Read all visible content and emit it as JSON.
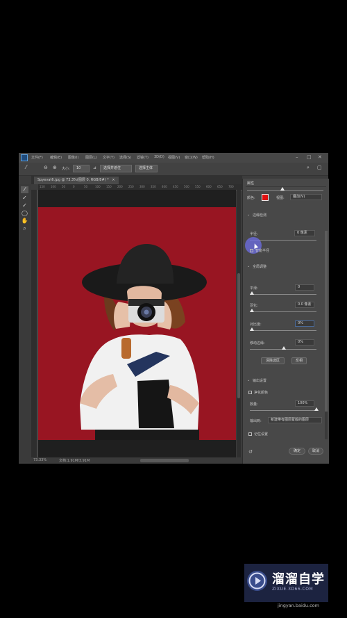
{
  "colors": {
    "canvas": "#981522",
    "swatch": "#e11010",
    "app_bg": "#3c3c3c",
    "cursor": "#6e6ee6"
  },
  "menubar": {
    "items": [
      "文件(F)",
      "编辑(E)",
      "图像(I)",
      "图层(L)",
      "文字(Y)",
      "选择(S)",
      "滤镜(T)",
      "3D(D)",
      "视图(V)",
      "窗口(W)",
      "帮助(H)"
    ]
  },
  "optionsbar": {
    "size_label": "大小:",
    "size_value": "10",
    "select_subject": "选择并遮住",
    "refine": "选择主体"
  },
  "document": {
    "tab_title": "Spyevat6.jpg @ 73.3%(图层 0, RGB/8#) *"
  },
  "ruler": {
    "top_numbers": [
      "150",
      "100",
      "50",
      "0",
      "50",
      "100",
      "150",
      "200",
      "250",
      "300",
      "350",
      "400",
      "450",
      "500",
      "550",
      "600",
      "650",
      "700"
    ]
  },
  "statusbar": {
    "zoom": "73.33%",
    "doc_size": "文档:1.91M/3.91M"
  },
  "panel": {
    "title": "属性",
    "view_mode_label": "视图:",
    "color_label": "颜色:",
    "view_mode_value": "叠加(V)",
    "edge_detection_title": "边缘检测",
    "radius_label": "半径:",
    "radius_value": "0 像素",
    "smart_radius": "智能半径",
    "global_refine_title": "全局调整",
    "smooth_label": "平滑:",
    "smooth_value": "0",
    "feather_label": "羽化:",
    "feather_value": "0.0 像素",
    "contrast_label": "对比度:",
    "contrast_value": "0%",
    "shift_edge_label": "移动边缘:",
    "shift_edge_value": "0%",
    "clear_selection": "清除选区",
    "invert": "反相",
    "output_title": "输出设置",
    "decontaminate": "净化颜色",
    "amount_label": "数量:",
    "amount_value": "100%",
    "output_to_label": "输出到:",
    "output_to_value": "新建带有图层蒙版的图层",
    "remember": "记住设置",
    "ok": "确定",
    "cancel": "取消"
  },
  "watermark": {
    "brand_cn": "溜溜自学",
    "brand_en": "ZIXUE.3D66.COM"
  },
  "credit": "jingyan.baidu.com"
}
